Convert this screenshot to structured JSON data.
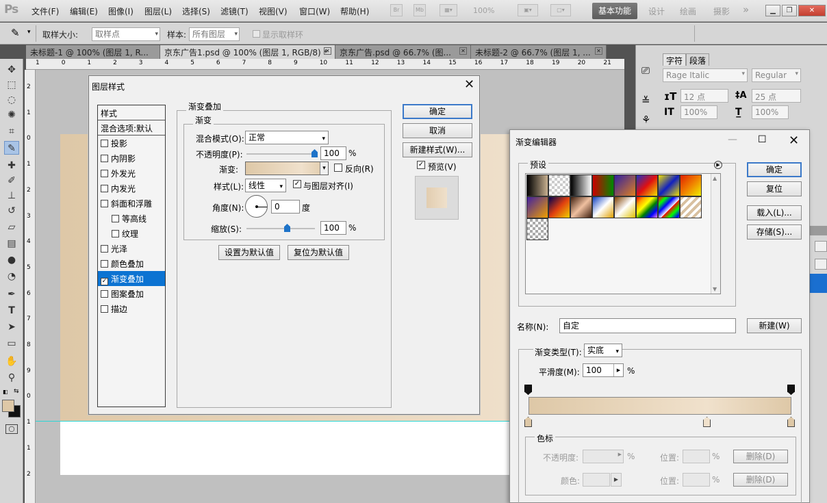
{
  "app": {
    "logo": "Ps"
  },
  "menu": [
    "文件(F)",
    "编辑(E)",
    "图像(I)",
    "图层(L)",
    "选择(S)",
    "滤镜(T)",
    "视图(V)",
    "窗口(W)",
    "帮助(H)"
  ],
  "appbar": {
    "zoom": "100%",
    "workspaces": [
      "基本功能",
      "设计",
      "绘画",
      "摄影"
    ],
    "more": "»"
  },
  "options": {
    "sample_size_label": "取样大小:",
    "sample_size_value": "取样点",
    "sample_label": "样本:",
    "sample_value": "所有图层",
    "show_ring_label": "显示取样环"
  },
  "doc_tabs": [
    {
      "label": "未标题-1 @ 100% (图层 1, R..."
    },
    {
      "label": "京东广告1.psd @ 100% (图层 1, RGB/8) *"
    },
    {
      "label": "京东广告.psd @ 66.7% (图..."
    },
    {
      "label": "未标题-2 @ 66.7% (图层 1, ..."
    }
  ],
  "ruler_top": [
    "1",
    "0",
    "1",
    "2",
    "3",
    "4",
    "5",
    "6",
    "7",
    "8",
    "9",
    "10",
    "11",
    "12",
    "13",
    "14",
    "15",
    "16",
    "17",
    "18",
    "19",
    "20",
    "21"
  ],
  "ruler_left": [
    "2",
    "1",
    "0",
    "1",
    "2",
    "3",
    "4",
    "5",
    "6",
    "7",
    "8",
    "9",
    "0",
    "1",
    "1",
    "2"
  ],
  "char_panel": {
    "tabs": [
      "字符",
      "段落"
    ],
    "font_family": "Rage Italic",
    "font_style": "Regular",
    "size": "12 点",
    "leading": "25 点",
    "vscale": "100%",
    "hscale": "100%"
  },
  "layer_style": {
    "title": "图层样式",
    "styles_header": "样式",
    "blend_default": "混合选项:默认",
    "items": [
      {
        "label": "投影",
        "checked": false,
        "indent": false
      },
      {
        "label": "内阴影",
        "checked": false,
        "indent": false
      },
      {
        "label": "外发光",
        "checked": false,
        "indent": false
      },
      {
        "label": "内发光",
        "checked": false,
        "indent": false
      },
      {
        "label": "斜面和浮雕",
        "checked": false,
        "indent": false
      },
      {
        "label": "等高线",
        "checked": false,
        "indent": true
      },
      {
        "label": "纹理",
        "checked": false,
        "indent": true
      },
      {
        "label": "光泽",
        "checked": false,
        "indent": false
      },
      {
        "label": "颜色叠加",
        "checked": false,
        "indent": false
      },
      {
        "label": "渐变叠加",
        "checked": true,
        "indent": false,
        "selected": true
      },
      {
        "label": "图案叠加",
        "checked": false,
        "indent": false
      },
      {
        "label": "描边",
        "checked": false,
        "indent": false
      }
    ],
    "section_title": "渐变叠加",
    "sub_title": "渐变",
    "blend_mode_label": "混合模式(O):",
    "blend_mode_value": "正常",
    "opacity_label": "不透明度(P):",
    "opacity_value": "100",
    "opacity_unit": "%",
    "gradient_label": "渐变:",
    "reverse_label": "反向(R)",
    "style_label": "样式(L):",
    "style_value": "线性",
    "align_label": "与图层对齐(I)",
    "angle_label": "角度(N):",
    "angle_value": "0",
    "angle_unit": "度",
    "scale_label": "缩放(S):",
    "scale_value": "100",
    "scale_unit": "%",
    "set_default": "设置为默认值",
    "reset_default": "复位为默认值",
    "ok": "确定",
    "cancel": "取消",
    "new_style": "新建样式(W)...",
    "preview_label": "预览(V)",
    "opacity_level": 1.0,
    "scale_level": 0.6
  },
  "gradient_editor": {
    "title": "渐变编辑器",
    "presets_label": "预设",
    "ok": "确定",
    "reset": "复位",
    "load": "载入(L)...",
    "save": "存储(S)...",
    "name_label": "名称(N):",
    "name_value": "自定",
    "new": "新建(W)",
    "type_label": "渐变类型(T):",
    "type_value": "实底",
    "smooth_label": "平滑度(M):",
    "smooth_value": "100",
    "smooth_unit": "%",
    "stops_group": "色标",
    "stop_opacity_label": "不透明度:",
    "stop_opacity_unit": "%",
    "position_label": "位置:",
    "position_unit": "%",
    "delete_label": "删除(D)",
    "color_label": "颜色:",
    "gradient_colors": [
      "#dec8a7",
      "#f0e1cc",
      "#dec8a7"
    ],
    "color_stop_positions": [
      0,
      0.68,
      1.0
    ],
    "opacity_stop_positions": [
      0,
      1.0
    ]
  },
  "colors": {
    "foreground": "#dec8a7",
    "background": "#111111",
    "accent": "#0c73d2"
  }
}
